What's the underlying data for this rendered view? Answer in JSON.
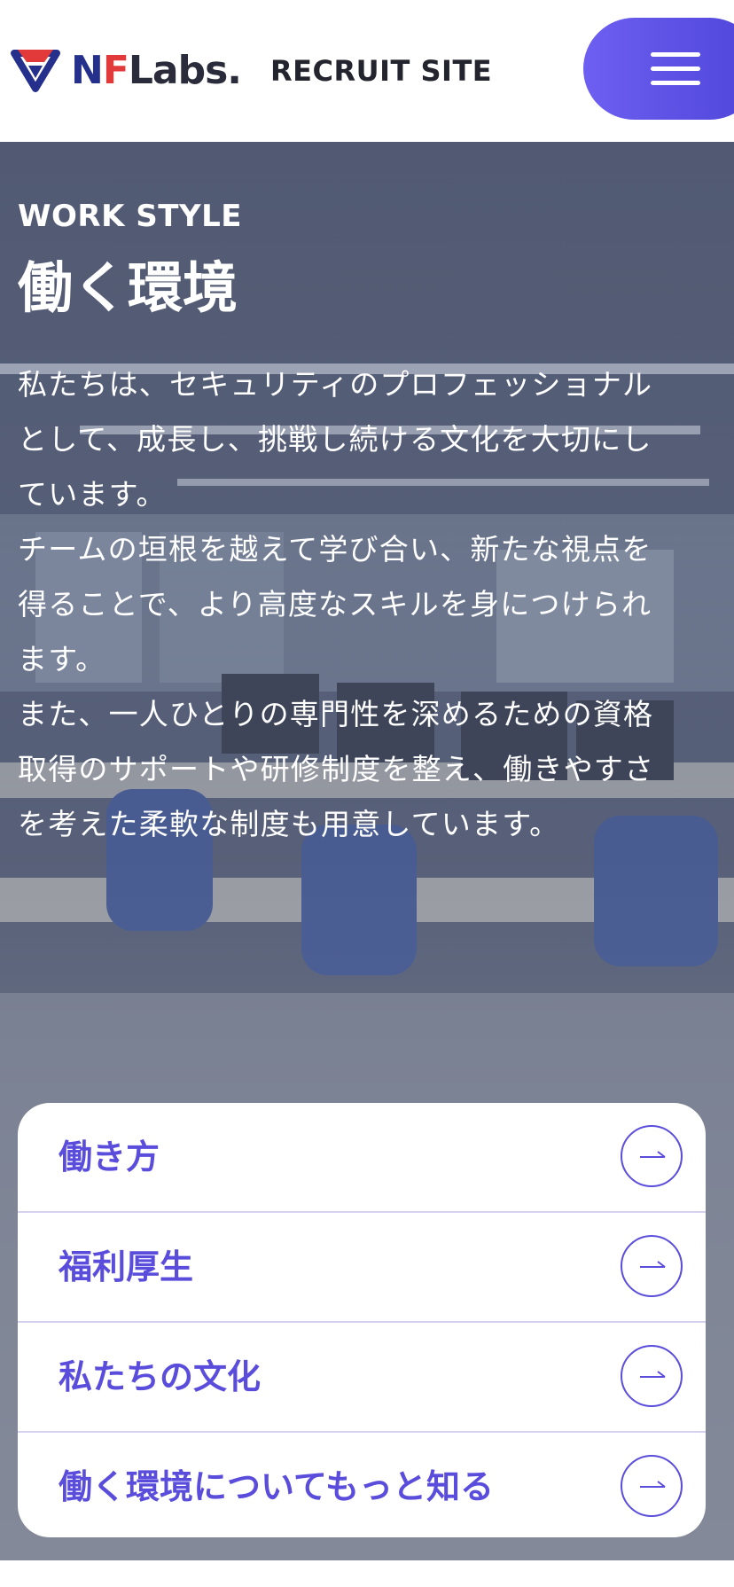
{
  "header": {
    "brand_n": "N",
    "brand_f": "F",
    "brand_rest": "Labs.",
    "site_label": "RECRUIT SITE",
    "logo_icon": "nflabs-logo-icon",
    "menu_icon": "hamburger-menu-icon"
  },
  "hero": {
    "eyebrow": "WORK STYLE",
    "title": "働く環境",
    "paragraphs": [
      "私たちは、セキュリティのプロフェッショナル\nとして、成長し、挑戦し続ける文化を大切にし\nています。",
      "チームの垣根を越えて学び合い、新たな視点を\n得ることで、より高度なスキルを身につけられ\nます。",
      "また、一人ひとりの専門性を深めるための資格\n取得のサポートや研修制度を整え、働きやすさ\nを考えた柔軟な制度も用意しています。"
    ]
  },
  "links": [
    {
      "label": "働き方",
      "icon": "arrow-right-icon"
    },
    {
      "label": "福利厚生",
      "icon": "arrow-right-icon"
    },
    {
      "label": "私たちの文化",
      "icon": "arrow-right-icon"
    },
    {
      "label": "働く環境についてもっと知る",
      "icon": "arrow-right-icon"
    }
  ],
  "colors": {
    "accent": "#5a4ddc",
    "menu_gradient_start": "#6d5ff2",
    "menu_gradient_end": "#4e45d8",
    "brand_navy": "#24308c",
    "brand_red": "#e23a3a",
    "divider": "#d4d2ee"
  }
}
